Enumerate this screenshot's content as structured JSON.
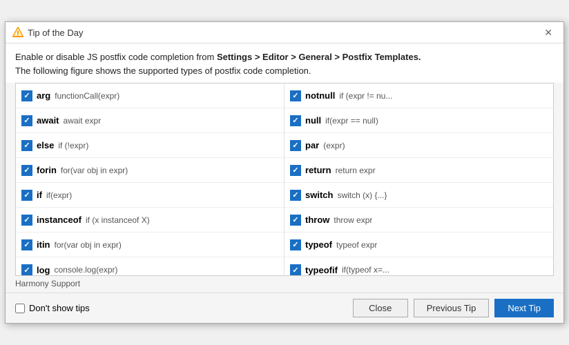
{
  "dialog": {
    "title": "Tip of the Day",
    "close_label": "✕"
  },
  "description": {
    "line1_prefix": "Enable or disable JS postfix code completion from ",
    "line1_path": "Settings > Editor > General > Postfix Templates.",
    "line2": "The following figure shows the supported types of postfix code completion."
  },
  "left_items": [
    {
      "keyword": "arg",
      "template": "functionCall(expr)"
    },
    {
      "keyword": "await",
      "template": "await expr"
    },
    {
      "keyword": "else",
      "template": "if (!expr)"
    },
    {
      "keyword": "forin",
      "template": "for(var obj in expr)"
    },
    {
      "keyword": "if",
      "template": "if(expr)"
    },
    {
      "keyword": "instanceof",
      "template": "if (x instanceof X)"
    },
    {
      "keyword": "itin",
      "template": "for(var obj in expr)"
    },
    {
      "keyword": "log",
      "template": "console.log(expr)"
    }
  ],
  "right_items": [
    {
      "keyword": "notnull",
      "template": "if (expr != nu..."
    },
    {
      "keyword": "null",
      "template": "if(expr == null)"
    },
    {
      "keyword": "par",
      "template": "(expr)"
    },
    {
      "keyword": "return",
      "template": "return expr"
    },
    {
      "keyword": "switch",
      "template": "switch (x) {...}"
    },
    {
      "keyword": "throw",
      "template": "throw expr"
    },
    {
      "keyword": "typeof",
      "template": "typeof expr"
    },
    {
      "keyword": "typeofif",
      "template": "if(typeof x=..."
    }
  ],
  "footer_hint": "Harmony Support",
  "bottom": {
    "dont_show_label": "Don't show tips",
    "close_button": "Close",
    "prev_button": "Previous Tip",
    "next_button": "Next Tip"
  }
}
